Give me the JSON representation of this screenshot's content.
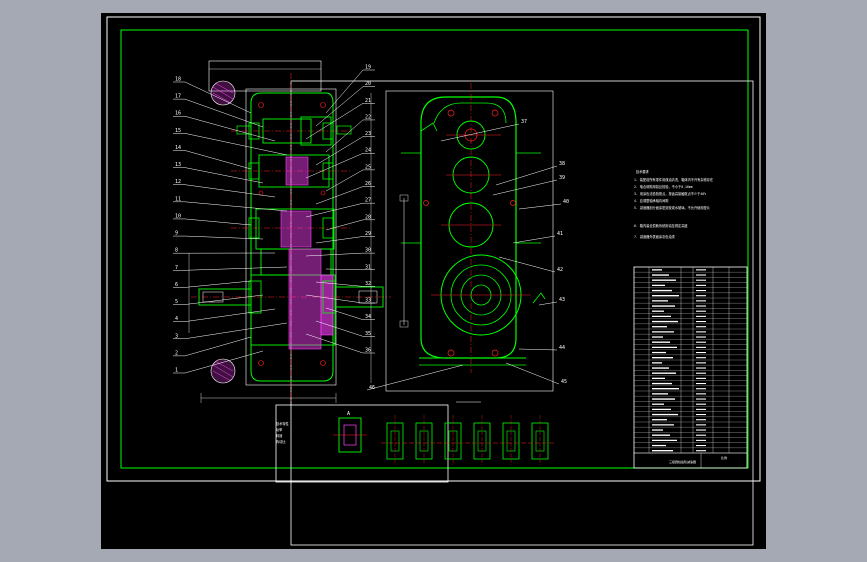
{
  "canvas": {
    "background_color": "#a5a9b3",
    "sheet_color": "#000000"
  },
  "colors": {
    "frame": "#ffffff",
    "inner_frame": "#00ff00",
    "outline": "#00ff00",
    "centerline": "#ff2020",
    "hatch": "#ff40ff",
    "leader": "#ffffff",
    "dimension": "#ffffff",
    "text": "#ffffff"
  },
  "left_view": {
    "balloons_left": [
      "18",
      "17",
      "16",
      "15",
      "14",
      "13",
      "12",
      "11",
      "10",
      "9",
      "8",
      "7",
      "6",
      "5",
      "4",
      "3",
      "2",
      "1"
    ],
    "balloons_right": [
      "19",
      "20",
      "21",
      "22",
      "23",
      "24",
      "25",
      "26",
      "27",
      "28",
      "29",
      "30",
      "31",
      "32",
      "33",
      "34",
      "35",
      "36"
    ]
  },
  "front_view": {
    "balloons": [
      "37",
      "38",
      "39",
      "40",
      "41",
      "42",
      "43",
      "44",
      "45",
      "46"
    ]
  },
  "technical_requirements": {
    "title": "技术要求",
    "lines": [
      "1. 装配前所有零件用煤油清洗，箱体内不许有杂物存在",
      "2. 啮合侧隙用铅丝检验，不小于0.16mm",
      "3. 用涂色法检验斑点，按齿高接触斑点不少于40%",
      "4. 应调整轴承轴向间隙",
      "5. 减速器剖分面涂密封胶或水玻璃，不允许使用垫片",
      "6. 箱内装全损耗系统用油至规定高度",
      "7. 减速器外表面涂灰色油漆"
    ]
  },
  "parts_table": {
    "rows": 36,
    "title_block": [
      "三级圆柱齿轮减速器",
      "比例",
      "数量"
    ]
  },
  "labels": {
    "view_a": "A",
    "spec_block": [
      "技术特性",
      "功率",
      "转速",
      "传动比"
    ]
  }
}
